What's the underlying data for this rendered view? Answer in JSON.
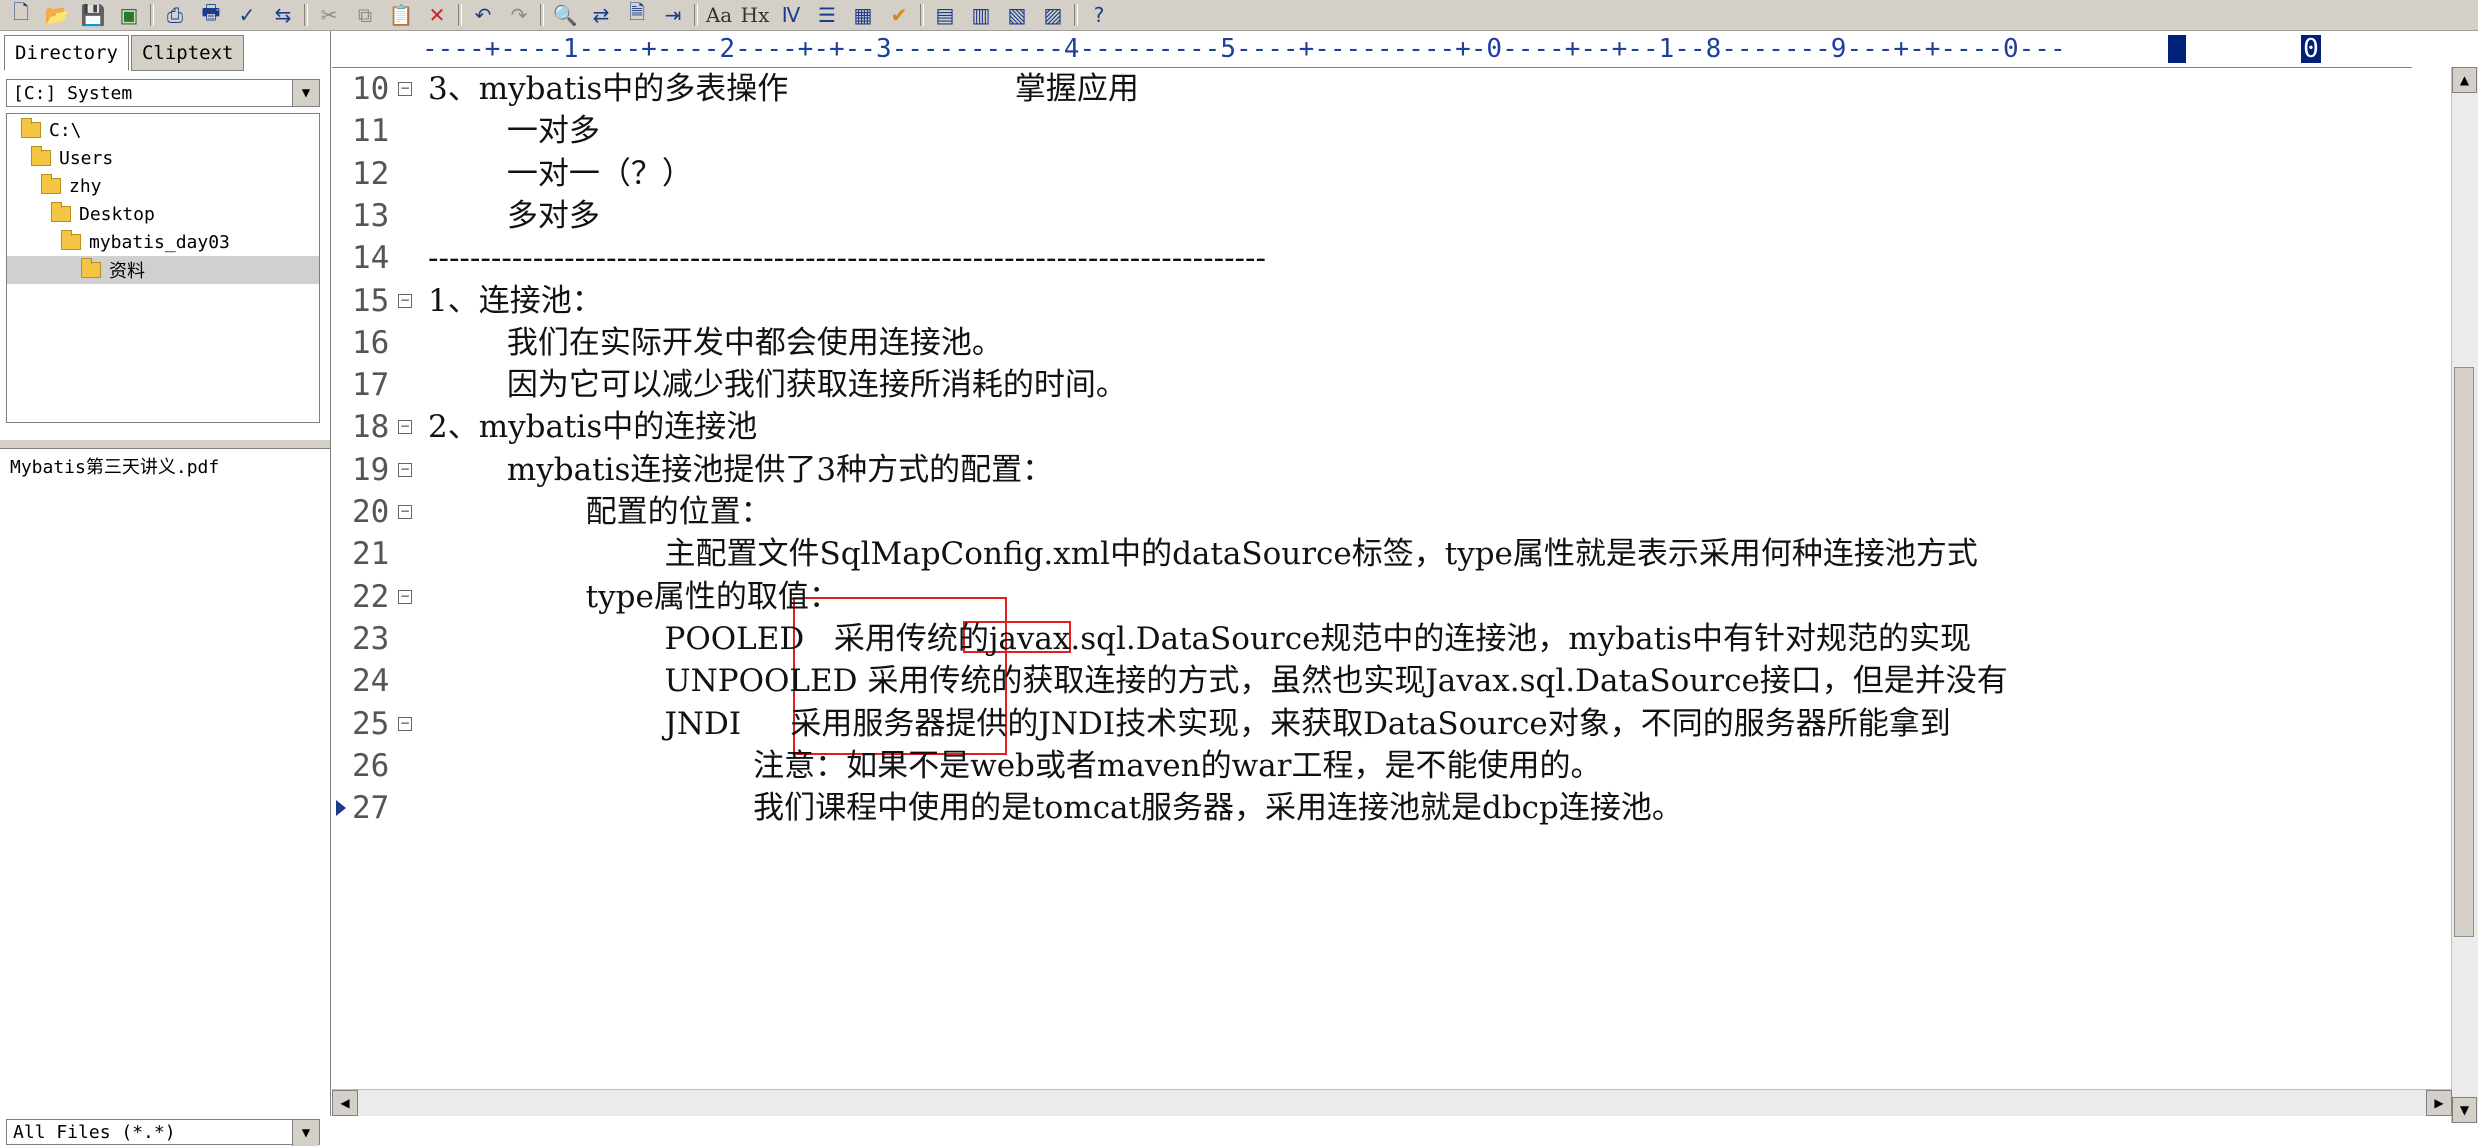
{
  "toolbar": {
    "buttons": [
      "new-file",
      "open",
      "save",
      "save-all",
      "print-preview",
      "print",
      "spell-check",
      "compare",
      "cut",
      "copy",
      "paste",
      "delete",
      "undo",
      "redo",
      "find",
      "replace",
      "find-in-files",
      "goto",
      "font",
      "hex",
      "word-wrap",
      "indent",
      "column-mode",
      "check",
      "view-1",
      "view-2",
      "view-3",
      "view-4",
      "help"
    ],
    "font_label": "Aa",
    "hex_label": "Hx"
  },
  "left_panel": {
    "tabs": [
      "Directory",
      "Cliptext"
    ],
    "drive_select": "[C:] System",
    "tree": [
      {
        "label": "C:\\",
        "depth": 0
      },
      {
        "label": "Users",
        "depth": 1
      },
      {
        "label": "zhy",
        "depth": 2
      },
      {
        "label": "Desktop",
        "depth": 3
      },
      {
        "label": "mybatis_day03",
        "depth": 4
      },
      {
        "label": "资料",
        "depth": 5,
        "selected": true
      }
    ],
    "files": [
      "Mybatis第三天讲义.pdf"
    ],
    "filter_select": "All Files (*.*)"
  },
  "ruler": {
    "text": "----+----1----+----2----+-+--3-----------4---------5----+---------+-0----+--+--1--8-------9---+-+----0---",
    "marks": [
      "",
      "0"
    ]
  },
  "editor": {
    "lines": [
      {
        "num": "10",
        "fold": true,
        "text": "3、mybatis中的多表操作                       掌握应用"
      },
      {
        "num": "11",
        "fold": false,
        "text": "        一对多"
      },
      {
        "num": "12",
        "fold": false,
        "text": "        一对一（？）"
      },
      {
        "num": "13",
        "fold": false,
        "text": "        多对多"
      },
      {
        "num": "14",
        "fold": false,
        "text": "--------------------------------------------------------------------------------"
      },
      {
        "num": "15",
        "fold": true,
        "text": "1、连接池："
      },
      {
        "num": "16",
        "fold": false,
        "text": "        我们在实际开发中都会使用连接池。"
      },
      {
        "num": "17",
        "fold": false,
        "text": "        因为它可以减少我们获取连接所消耗的时间。"
      },
      {
        "num": "18",
        "fold": true,
        "text": "2、mybatis中的连接池"
      },
      {
        "num": "19",
        "fold": true,
        "text": "        mybatis连接池提供了3种方式的配置："
      },
      {
        "num": "20",
        "fold": true,
        "text": "                配置的位置："
      },
      {
        "num": "21",
        "fold": false,
        "text": "                        主配置文件SqlMapConfig.xml中的dataSource标签，type属性就是表示采用何种连接池方式"
      },
      {
        "num": "22",
        "fold": true,
        "text": "                type属性的取值："
      },
      {
        "num": "23",
        "fold": false,
        "text": "                        POOLED   采用传统的javax.sql.DataSource规范中的连接池，mybatis中有针对规范的实现"
      },
      {
        "num": "24",
        "fold": false,
        "text": "                        UNPOOLED 采用传统的获取连接的方式，虽然也实现Javax.sql.DataSource接口，但是并没有"
      },
      {
        "num": "25",
        "fold": true,
        "text": "                        JNDI     采用服务器提供的JNDI技术实现，来获取DataSource对象，不同的服务器所能拿到"
      },
      {
        "num": "26",
        "fold": false,
        "text": "                                 注意：如果不是web或者maven的war工程，是不能使用的。"
      },
      {
        "num": "27",
        "fold": false,
        "text": "                                 我们课程中使用的是tomcat服务器，采用连接池就是dbcp连接池。"
      }
    ]
  },
  "colors": {
    "highlight_box": "#e02020",
    "ruler_text": "#1f3f9f",
    "toolbar_bg": "#d4d0c8"
  }
}
